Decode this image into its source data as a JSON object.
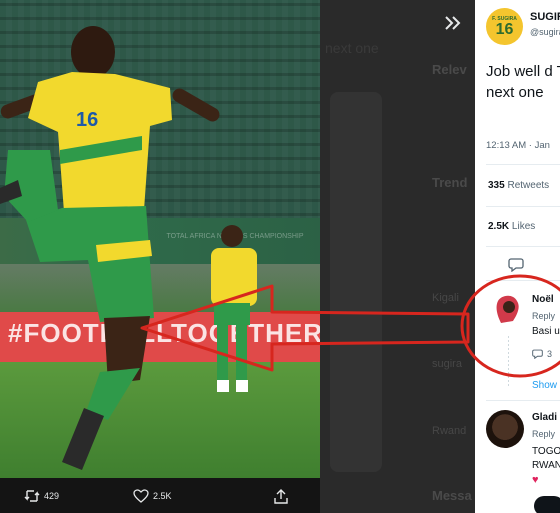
{
  "photo": {
    "adboard_bottom": "#FOOTBALLTOGETHER",
    "adboard_top": "TOTAL AFRICA NATIONS CHAMPIONSHIP",
    "jersey_number": "16"
  },
  "photo_actions": {
    "retweet_count": "429",
    "like_count": "2.5K"
  },
  "middle": {
    "faint_text": "next one",
    "labels": [
      "Relev",
      "Trend",
      "Messa"
    ],
    "smalls": [
      "Kigali",
      "sugira",
      "Rwand"
    ]
  },
  "tweet": {
    "avatar_small": "F. SUGIRA",
    "avatar_number": "16",
    "author_name": "SUGIRA",
    "author_handle": "@sugira",
    "text": "Job well d Thankyou next one",
    "time": "12:13 AM · Jan",
    "retweets_count": "335",
    "retweets_label": "Retweets",
    "likes_count": "2.5K",
    "likes_label": "Likes"
  },
  "reply1": {
    "name": "Noël",
    "meta": "Reply",
    "text": "Basi u",
    "count": "3",
    "show_more": "Show"
  },
  "reply2": {
    "name": "Gladi",
    "meta": "Reply",
    "line1": "TOGO",
    "line2": "RWAN",
    "heart": "♥"
  },
  "colors": {
    "annotation_red": "#d7261e",
    "twitter_blue": "#1d9bf0",
    "jersey_yellow": "#f2d92d",
    "shorts_green": "#2f9a4a"
  }
}
